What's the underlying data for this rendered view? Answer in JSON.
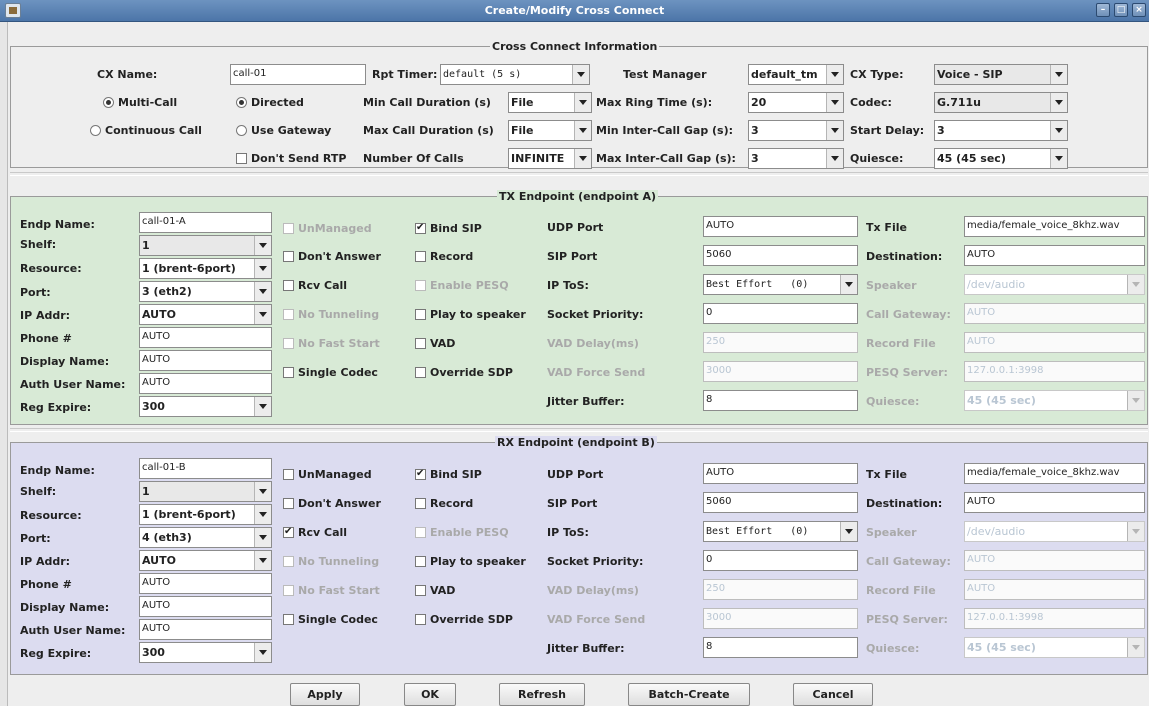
{
  "window": {
    "title": "Create/Modify Cross Connect"
  },
  "cx": {
    "section_title": "Cross Connect Information",
    "cx_name_label": "CX Name:",
    "cx_name_value": "call-01",
    "rpt_timer_label": "Rpt Timer:",
    "rpt_timer_value": "default (5 s)",
    "test_manager_label": "Test Manager",
    "test_manager_value": "default_tm",
    "cx_type_label": "CX Type:",
    "cx_type_value": "Voice - SIP",
    "multi_call_label": "Multi-Call",
    "directed_label": "Directed",
    "continuous_call_label": "Continuous Call",
    "use_gateway_label": "Use Gateway",
    "dont_send_rtp_label": "Don't Send RTP",
    "min_call_duration_label": "Min Call Duration (s)",
    "min_call_duration_value": "File",
    "max_call_duration_label": "Max Call Duration (s)",
    "max_call_duration_value": "File",
    "number_of_calls_label": "Number Of Calls",
    "number_of_calls_value": "INFINITE",
    "max_ring_time_label": "Max Ring Time (s):",
    "max_ring_time_value": "20",
    "min_inter_call_gap_label": "Min Inter-Call Gap (s):",
    "min_inter_call_gap_value": "3",
    "max_inter_call_gap_label": "Max Inter-Call Gap (s):",
    "max_inter_call_gap_value": "3",
    "codec_label": "Codec:",
    "codec_value": "G.711u",
    "start_delay_label": "Start Delay:",
    "start_delay_value": "3",
    "quiesce_label": "Quiesce:",
    "quiesce_value": "45 (45 sec)"
  },
  "tx": {
    "section_title": "TX Endpoint (endpoint A)",
    "endp_name_label": "Endp Name:",
    "endp_name_value": "call-01-A",
    "shelf_label": "Shelf:",
    "shelf_value": "1",
    "resource_label": "Resource:",
    "resource_value": "1 (brent-6port)",
    "port_label": "Port:",
    "port_value": "3 (eth2)",
    "ip_addr_label": "IP Addr:",
    "ip_addr_value": "AUTO",
    "phone_label": "Phone #",
    "phone_value": "AUTO",
    "display_name_label": "Display Name:",
    "display_name_value": "AUTO",
    "auth_user_label": "Auth User Name:",
    "auth_user_value": "AUTO",
    "reg_expire_label": "Reg Expire:",
    "reg_expire_value": "300",
    "unmanaged": "UnManaged",
    "dont_answer": "Don't Answer",
    "rcv_call": "Rcv Call",
    "no_tunneling": "No Tunneling",
    "no_fast_start": "No Fast Start",
    "single_codec": "Single Codec",
    "bind_sip": "Bind SIP",
    "record": "Record",
    "enable_pesq": "Enable PESQ",
    "play_to_speaker": "Play to speaker",
    "vad": "VAD",
    "override_sdp": "Override SDP",
    "udp_port_label": "UDP Port",
    "udp_port_value": "AUTO",
    "sip_port_label": "SIP Port",
    "sip_port_value": "5060",
    "ip_tos_label": "IP ToS:",
    "ip_tos_value": "Best Effort   (0)",
    "socket_priority_label": "Socket Priority:",
    "socket_priority_value": "0",
    "vad_delay_label": "VAD Delay(ms)",
    "vad_delay_value": "250",
    "vad_force_send_label": "VAD Force Send",
    "vad_force_send_value": "3000",
    "jitter_buffer_label": "Jitter Buffer:",
    "jitter_buffer_value": "8",
    "tx_file_label": "Tx File",
    "tx_file_value": "media/female_voice_8khz.wav",
    "destination_label": "Destination:",
    "destination_value": "AUTO",
    "speaker_label": "Speaker",
    "speaker_value": "/dev/audio",
    "call_gateway_label": "Call Gateway:",
    "call_gateway_value": "AUTO",
    "record_file_label": "Record File",
    "record_file_value": "AUTO",
    "pesq_server_label": "PESQ Server:",
    "pesq_server_value": "127.0.0.1:3998",
    "quiesce_label": "Quiesce:",
    "quiesce_value": "45 (45 sec)"
  },
  "rx": {
    "section_title": "RX Endpoint (endpoint B)",
    "endp_name_label": "Endp Name:",
    "endp_name_value": "call-01-B",
    "shelf_label": "Shelf:",
    "shelf_value": "1",
    "resource_label": "Resource:",
    "resource_value": "1 (brent-6port)",
    "port_label": "Port:",
    "port_value": "4 (eth3)",
    "ip_addr_label": "IP Addr:",
    "ip_addr_value": "AUTO",
    "phone_label": "Phone #",
    "phone_value": "AUTO",
    "display_name_label": "Display Name:",
    "display_name_value": "AUTO",
    "auth_user_label": "Auth User Name:",
    "auth_user_value": "AUTO",
    "reg_expire_label": "Reg Expire:",
    "reg_expire_value": "300",
    "unmanaged": "UnManaged",
    "dont_answer": "Don't Answer",
    "rcv_call": "Rcv Call",
    "no_tunneling": "No Tunneling",
    "no_fast_start": "No Fast Start",
    "single_codec": "Single Codec",
    "bind_sip": "Bind SIP",
    "record": "Record",
    "enable_pesq": "Enable PESQ",
    "play_to_speaker": "Play to speaker",
    "vad": "VAD",
    "override_sdp": "Override SDP",
    "udp_port_label": "UDP Port",
    "udp_port_value": "AUTO",
    "sip_port_label": "SIP Port",
    "sip_port_value": "5060",
    "ip_tos_label": "IP ToS:",
    "ip_tos_value": "Best Effort   (0)",
    "socket_priority_label": "Socket Priority:",
    "socket_priority_value": "0",
    "vad_delay_label": "VAD Delay(ms)",
    "vad_delay_value": "250",
    "vad_force_send_label": "VAD Force Send",
    "vad_force_send_value": "3000",
    "jitter_buffer_label": "Jitter Buffer:",
    "jitter_buffer_value": "8",
    "tx_file_label": "Tx File",
    "tx_file_value": "media/female_voice_8khz.wav",
    "destination_label": "Destination:",
    "destination_value": "AUTO",
    "speaker_label": "Speaker",
    "speaker_value": "/dev/audio",
    "call_gateway_label": "Call Gateway:",
    "call_gateway_value": "AUTO",
    "record_file_label": "Record File",
    "record_file_value": "AUTO",
    "pesq_server_label": "PESQ Server:",
    "pesq_server_value": "127.0.0.1:3998",
    "quiesce_label": "Quiesce:",
    "quiesce_value": "45 (45 sec)"
  },
  "buttons": {
    "apply": "Apply",
    "ok": "OK",
    "refresh": "Refresh",
    "batch_create": "Batch-Create",
    "cancel": "Cancel"
  },
  "colors": {
    "tx_panel": "#d8ead6",
    "rx_panel": "#dcdcf0",
    "title_bar": "#5a82b3"
  }
}
